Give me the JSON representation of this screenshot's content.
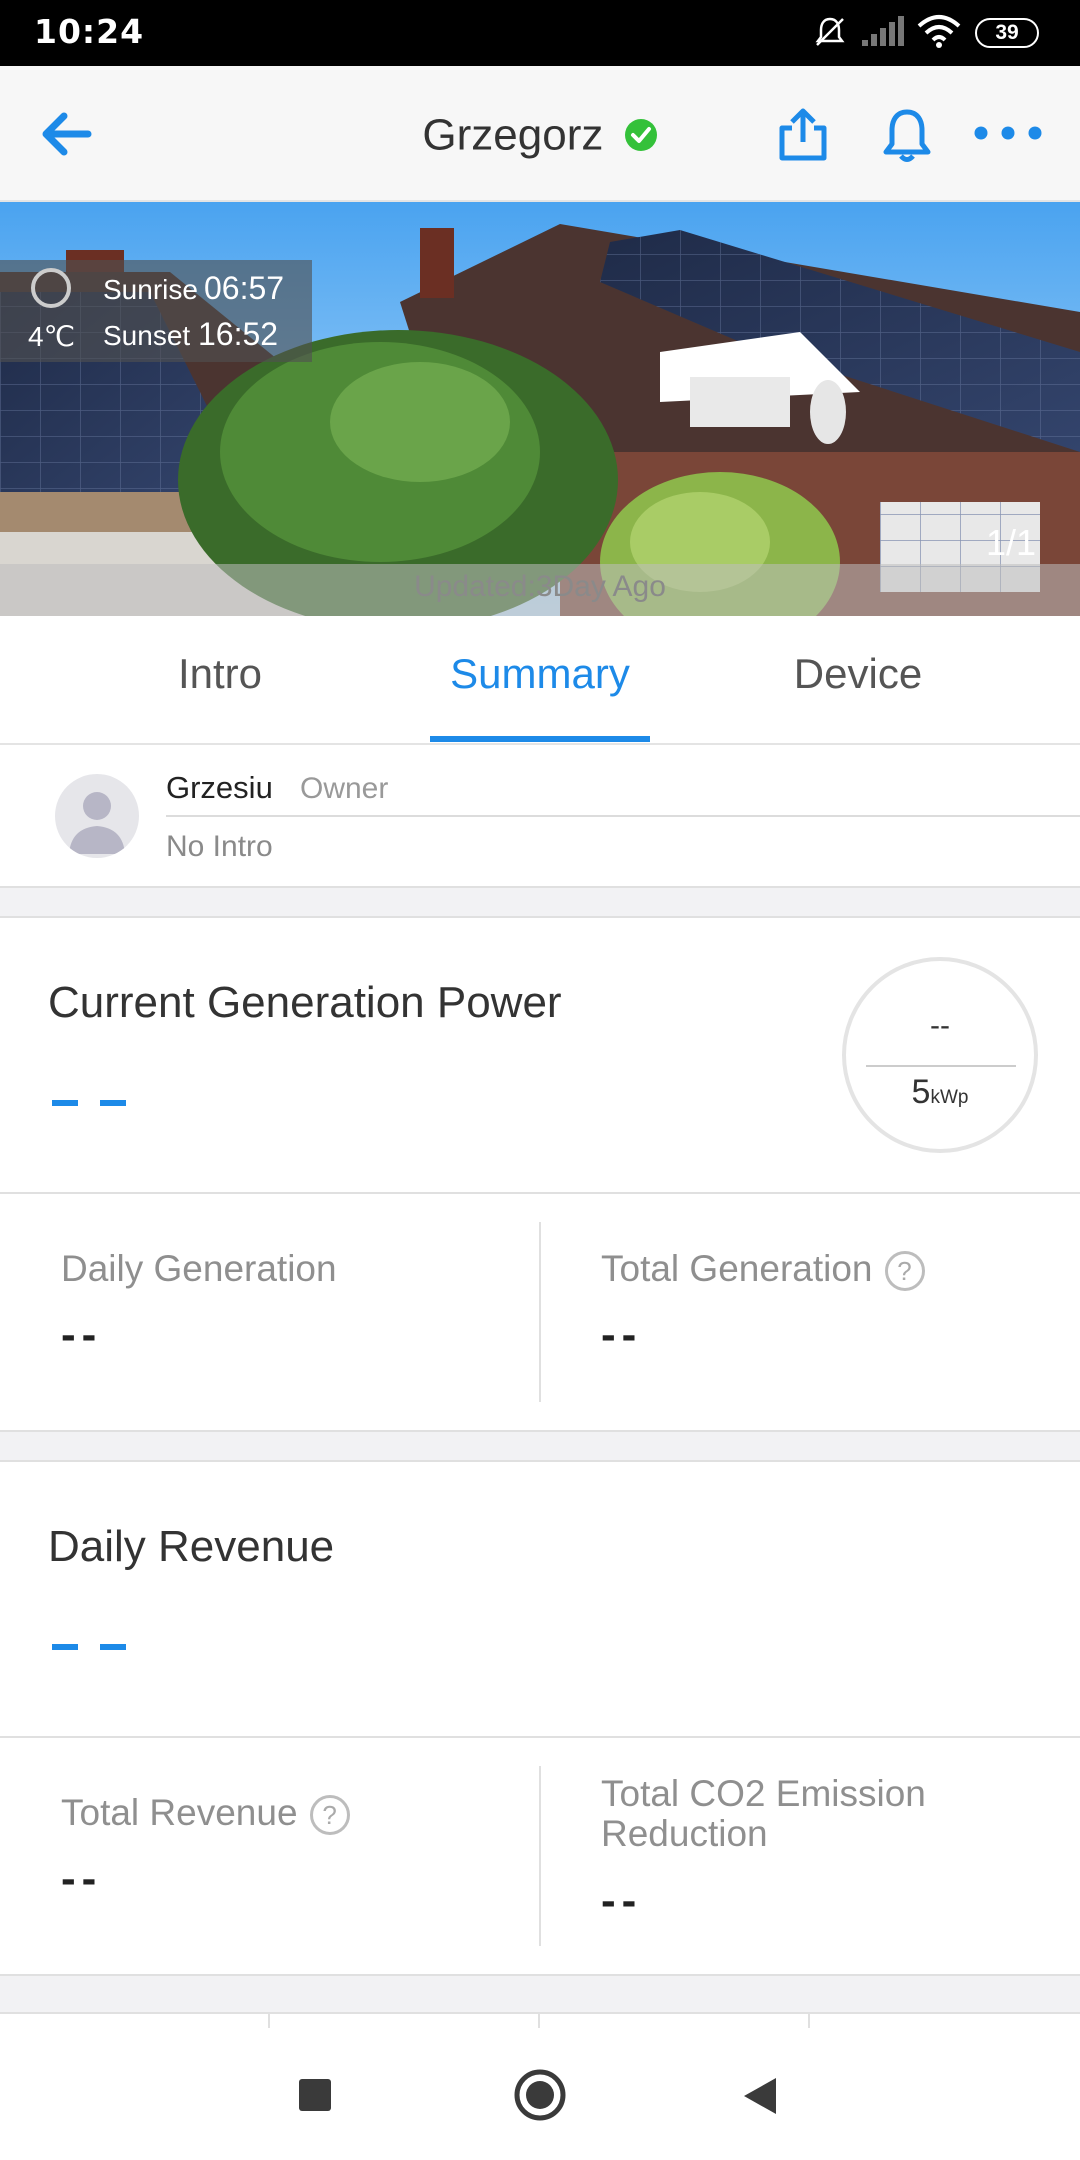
{
  "status_bar": {
    "time": "10:24",
    "battery": "39",
    "icons": [
      "mute-icon",
      "signal-icon",
      "wifi-icon",
      "battery-icon"
    ]
  },
  "header": {
    "title": "Grzegorz",
    "back_icon": "arrow-left-icon",
    "verified_icon": "check-circle-icon",
    "share_icon": "share-icon",
    "bell_icon": "bell-icon",
    "more_icon": "more-icon",
    "accent_color": "#1d8ae8"
  },
  "hero": {
    "temperature": "4℃",
    "sunrise_label": "Sunrise",
    "sunrise_time": "06:57",
    "sunset_label": "Sunset",
    "sunset_time": "16:52",
    "page_count": "1/1",
    "updated": "Updated:3Day Ago"
  },
  "tabs": [
    {
      "label": "Intro"
    },
    {
      "label": "Summary"
    },
    {
      "label": "Device"
    }
  ],
  "owner": {
    "name": "Grzesiu",
    "role": "Owner",
    "intro": "No Intro"
  },
  "generation": {
    "current_label": "Current Generation Power",
    "gauge_value": "--",
    "capacity": "5",
    "capacity_unit": "kWp",
    "daily_label": "Daily Generation",
    "daily_value": "--",
    "total_label": "Total Generation",
    "total_value": "--"
  },
  "revenue": {
    "daily_label": "Daily Revenue",
    "total_label": "Total Revenue",
    "total_value": "--",
    "co2_label_line1": "Total CO2 Emission",
    "co2_label_line2": "Reduction",
    "co2_value": "--"
  },
  "help_glyph": "?"
}
